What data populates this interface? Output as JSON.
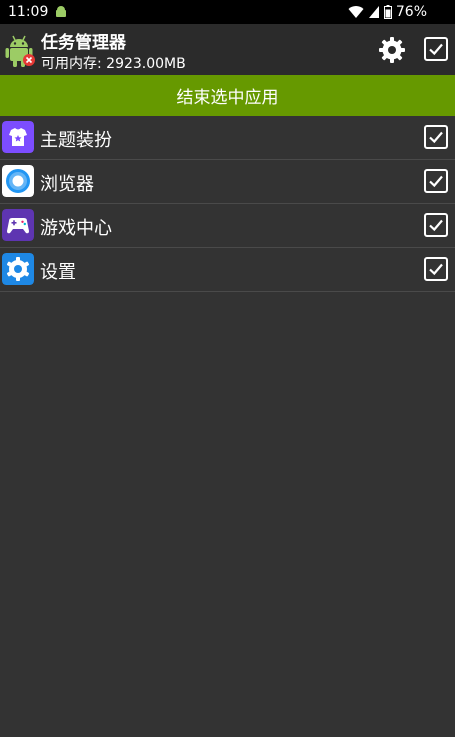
{
  "status_bar": {
    "time": "11:09",
    "battery": "76%"
  },
  "header": {
    "title": "任务管理器",
    "subtitle": "可用内存: 2923.00MB",
    "settings_icon": "gear-icon",
    "select_all_checked": true
  },
  "action": {
    "end_label": "结束选中应用",
    "accent_color": "#669900"
  },
  "apps": [
    {
      "label": "主题装扮",
      "icon": "theme-icon",
      "checked": true
    },
    {
      "label": "浏览器",
      "icon": "browser-icon",
      "checked": true
    },
    {
      "label": "游戏中心",
      "icon": "game-center-icon",
      "checked": true
    },
    {
      "label": "设置",
      "icon": "settings-icon",
      "checked": true
    }
  ]
}
